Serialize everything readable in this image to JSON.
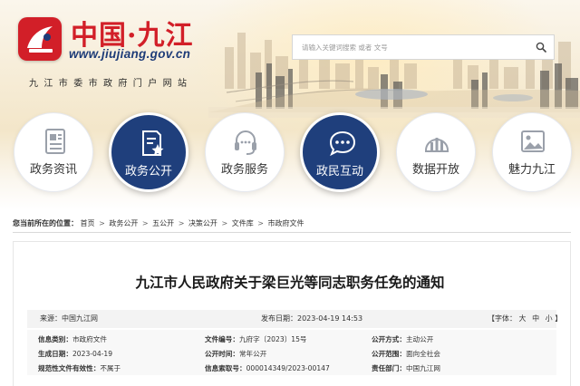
{
  "site": {
    "title": "中国·九江",
    "url": "www.jiujiang.gov.cn",
    "slogan": "九江市委市政府门户网站",
    "emblem_color": "#d21f28"
  },
  "search": {
    "placeholder": "请输入关键词搜索 或者 文号",
    "button_icon": "search-icon"
  },
  "nav": [
    {
      "label": "政务资讯",
      "icon": "news-document-icon",
      "active": false
    },
    {
      "label": "政务公开",
      "icon": "document-star-icon",
      "active": true
    },
    {
      "label": "政务服务",
      "icon": "headset-icon",
      "active": false
    },
    {
      "label": "政民互动",
      "icon": "chat-bubble-icon",
      "active": true
    },
    {
      "label": "数据开放",
      "icon": "bar-chart-icon",
      "active": false
    },
    {
      "label": "魅力九江",
      "icon": "picture-icon",
      "active": false
    }
  ],
  "breadcrumb": {
    "label": "您当前所在的位置：",
    "items": [
      "首页",
      "政务公开",
      "五公开",
      "决策公开",
      "文件库",
      "市政府文件"
    ],
    "separator": ">"
  },
  "article": {
    "title": "九江市人民政府关于梁巨光等同志职务任免的通知",
    "source": "来源：中国九江网",
    "published": "发布日期：2023-04-19 14:53",
    "font_label": "【字体：",
    "font_sizes": [
      "大",
      "中",
      "小"
    ],
    "font_close": "】"
  },
  "info": {
    "category_key": "信息类别：",
    "category_val": "市政府文件",
    "doc_no_key": "文件编号：",
    "doc_no_val": "九府字〔2023〕15号",
    "method_key": "公开方式：",
    "method_val": "主动公开",
    "created_key": "生成日期：",
    "created_val": "2023-04-19",
    "time_key": "公开时间：",
    "time_val": "常年公开",
    "scope_key": "公开范围：",
    "scope_val": "面向全社会",
    "valid_key": "规范性文件有效性：",
    "valid_val": "不属于",
    "index_key": "信息索取号：",
    "index_val": "000014349/2023-00147",
    "dept_key": "责任部门：",
    "dept_val": "中国九江网"
  },
  "colors": {
    "brand_red": "#d21f28",
    "nav_dark": "#1f3f7c",
    "nav_light_icon": "#9aa0aa"
  }
}
